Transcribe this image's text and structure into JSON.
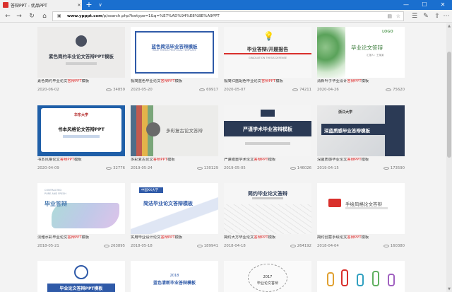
{
  "browser": {
    "tab_title": "答辩PPT - 优品PPT",
    "new_tab": "+",
    "tab_list": "∨",
    "url_host": "www.ypppt.com",
    "url_path": "/p/search.php?kwtype=1&q=%E7%AD%94%E8%BE%A9PPT",
    "minimize": "—",
    "maximize": "☐",
    "close": "✕"
  },
  "cards": [
    {
      "thumb_text": [
        "素色简约毕业论文答辩PPT模板"
      ],
      "title_pre": "素色简约毕业论文",
      "title_hl": "答辩PPT",
      "title_post": "模板",
      "date": "2020-06-02",
      "views": "34859"
    },
    {
      "thumb_text": [
        "蓝色简洁毕业答辩模板",
        "BLUE THESIS PROPOSAL TEMPLATE"
      ],
      "title_pre": "极简蓝色毕业论文",
      "title_hl": "答辩PPT",
      "title_post": "模板",
      "date": "2020-05-20",
      "views": "69917"
    },
    {
      "thumb_text": [
        "毕业答辩/开题报告",
        "GRADUATION THESIS DEFENSE"
      ],
      "title_pre": "极简红蓝配色毕业论文",
      "title_hl": "答辩PPT",
      "title_post": "模板",
      "date": "2020-05-07",
      "views": "74211"
    },
    {
      "thumb_text": [
        "毕业论文答辩",
        "LOGO",
        "汇报人：王某某"
      ],
      "title_pre": "清新叶子毕业设计",
      "title_hl": "答辩PPT",
      "title_post": "模板",
      "date": "2020-04-26",
      "views": "75620"
    },
    {
      "thumb_text": [
        "书本风格论文答辩PPT",
        "华东大学"
      ],
      "title_pre": "书本风格论文",
      "title_hl": "答辩PPT",
      "title_post": "模板",
      "date": "2020-04-09",
      "views": "32776"
    },
    {
      "thumb_text": [
        "多彩复古论文答辩"
      ],
      "title_pre": "多彩复古论文",
      "title_hl": "答辩PPT",
      "title_post": "模板",
      "date": "2019-05-24",
      "views": "130129"
    },
    {
      "thumb_text": [
        "严谨学术毕业答辩模板"
      ],
      "title_pre": "严谨稳重学术论文",
      "title_hl": "答辩PPT",
      "title_post": "模板",
      "date": "2019-05-05",
      "views": "146026"
    },
    {
      "thumb_text": [
        "深蓝质感毕业答辩模板",
        "浙江大学"
      ],
      "title_pre": "深蓝质感毕业论文",
      "title_hl": "答辩PPT",
      "title_post": "模板",
      "date": "2019-04-15",
      "views": "173590"
    },
    {
      "thumb_text": [
        "CONTRACTED",
        "PURE AND FRESH",
        "毕业答辩"
      ],
      "title_pre": "淡雅水彩毕业论文",
      "title_hl": "答辩PPT",
      "title_post": "模板",
      "date": "2018-05-21",
      "views": "263895"
    },
    {
      "thumb_text": [
        "中国XX大学",
        "简洁毕业论文答辩模板"
      ],
      "title_pre": "实用毕业设计论文",
      "title_hl": "答辩PPT",
      "title_post": "模板",
      "date": "2018-05-18",
      "views": "189941"
    },
    {
      "thumb_text": [
        "简约毕业论文答辩"
      ],
      "title_pre": "简约大方毕业论文",
      "title_hl": "答辩PPT",
      "title_post": "模板",
      "date": "2018-04-18",
      "views": "264192"
    },
    {
      "thumb_text": [
        "手绘风格论文答辩"
      ],
      "title_pre": "简约创意手绘论文",
      "title_hl": "答辩PPT",
      "title_post": "模板",
      "date": "2018-04-04",
      "views": "160380"
    },
    {
      "thumb_text": [
        "毕业论文答辩PPT模板"
      ]
    },
    {
      "thumb_text": [
        "2018",
        "蓝色清新毕业答辩模板"
      ]
    },
    {
      "thumb_text": [
        "2017",
        "毕业论文答辩"
      ]
    },
    {
      "thumb_text": []
    }
  ],
  "colors": {
    "accent_red": "#e02828",
    "titlebar": "#1a6fcf",
    "navy": "#2b3a55",
    "blue": "#2f5aa8"
  }
}
